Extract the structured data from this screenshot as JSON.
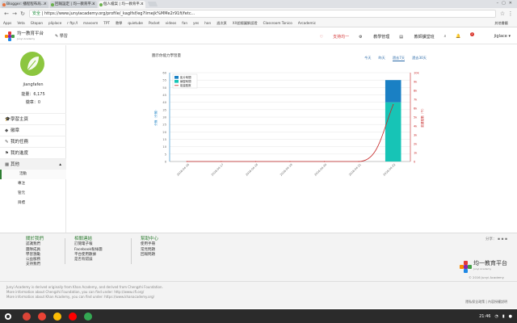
{
  "browser": {
    "tabs": [
      {
        "label": "Blogger: 播程程布局..."
      },
      {
        "label": "回報設定 | 均一教育平..."
      },
      {
        "label": "個人檔案 | 均一教育平..."
      }
    ],
    "url_secure": "安全",
    "url": "https://www.junyiacademy.org/profile/_kaglfsf/eg?limejk%MMe2r91fi/fetc...",
    "bookmarks": [
      "Apps",
      "Veta",
      "Gtopan",
      "pliplace",
      "r ftp:/l",
      "mavovm",
      "TPT",
      "教學",
      "quietube",
      "Pocket",
      "videos",
      "fan",
      "yes",
      "han",
      "週次頁",
      "XX超揚圖解認證",
      "Classroom Tonico",
      "Arcademic"
    ],
    "bookmarks_right": "其他書籤"
  },
  "header": {
    "logo_title": "均一教育平台",
    "logo_sub": "Junyi Academy",
    "learn": "學習",
    "support": "支持均一",
    "teacher": "教學管理",
    "tutor": "教師課堂班",
    "notif_count": "1",
    "user": "jiglace"
  },
  "profile": {
    "name": "jiangfafen",
    "energy": "能量：6,175",
    "badges": "徽章：0"
  },
  "menu": [
    {
      "icon": "graduation-cap-icon",
      "glyph": "🎓",
      "label": "學習主頁"
    },
    {
      "icon": "book-icon",
      "glyph": "◆",
      "label": "徽章"
    },
    {
      "icon": "pencil-icon",
      "glyph": "✎",
      "label": "我的任務"
    },
    {
      "icon": "flag-icon",
      "glyph": "⚑",
      "label": "我的進度"
    },
    {
      "icon": "folder-icon",
      "glyph": "▦",
      "label": "其他",
      "expanded": true
    }
  ],
  "submenu": [
    "活動",
    "專注",
    "管元",
    "目標"
  ],
  "chart_header": {
    "title": "圖示你能力學習量",
    "ranges": [
      "今天",
      "昨天",
      "過去7天",
      "過去30天"
    ],
    "selected_range": "過去7天"
  },
  "chart_data": {
    "type": "bar",
    "categories": [
      "2016-04-16",
      "2016-04-17",
      "2016-04-18",
      "2016-04-19",
      "2016-04-20",
      "2016-04-21",
      "2016-04-22"
    ],
    "series": [
      {
        "name": "影片時間",
        "values": [
          0,
          0,
          0,
          0,
          0,
          0,
          15
        ],
        "color": "#1a80c4"
      },
      {
        "name": "練習時間",
        "values": [
          0,
          0,
          0,
          0,
          0,
          0,
          40
        ],
        "color": "#17c4b6"
      },
      {
        "name": "能量點數",
        "type": "line",
        "axis": "right",
        "values": [
          0,
          0,
          0,
          0,
          0,
          0,
          6.4
        ],
        "color": "#c62828"
      }
    ],
    "legend_position": "top-left",
    "ylabel_left": "分鐘（分鐘）",
    "ylabel_right": "能量點數（千）",
    "ylim_left": [
      0,
      60
    ],
    "yticks_left": [
      0,
      5,
      10,
      15,
      20,
      25,
      30,
      35,
      40,
      45,
      50,
      55,
      60
    ],
    "ylim_right": [
      0,
      10
    ],
    "yticks_right": [
      "0",
      "1k",
      "2k",
      "3k",
      "4k",
      "5k",
      "6k",
      "7k",
      "8k",
      "9k",
      "10k"
    ],
    "grid": true
  },
  "footer": {
    "col1_title": "關於我們",
    "col1_items": [
      "認識我們",
      "團隊成員",
      "學習激勵",
      "公益服務",
      "支持我們"
    ],
    "col2_title": "相關連結",
    "col2_items": [
      "訂閱電子報",
      "Facebook粉絲團",
      "平台使用數據",
      "是否有錯誤"
    ],
    "col3_title": "幫助中心",
    "col3_items": [
      "使用手冊",
      "常見問題",
      "回報問題"
    ],
    "share": "分享：",
    "logo_title": "均一教育平台",
    "logo_sub": "Junyi Academy",
    "copyright": "© 2016 Junyi Academy"
  },
  "legal": {
    "line1": "Junyi Academy is derived originally from Khan Academy, and derived from Chengzhi Foundation.",
    "line2": "More information about Chengzhi Foundation, you can find under: http://www.cfi.org/",
    "line3": "More information about Khan Academy, you can find under: https://www.khanacademy.org/",
    "links": "隱私保全政策 | 內容授權說明"
  },
  "taskbar": {
    "time": "21:46",
    "apps": [
      {
        "name": "chrome-icon",
        "color": "#db4437"
      },
      {
        "name": "gmail-icon",
        "color": "#ea4335"
      },
      {
        "name": "drive-icon",
        "color": "#fbbc05"
      },
      {
        "name": "youtube-icon",
        "color": "#ff0000"
      },
      {
        "name": "play-store-icon",
        "color": "#34a853"
      }
    ]
  }
}
